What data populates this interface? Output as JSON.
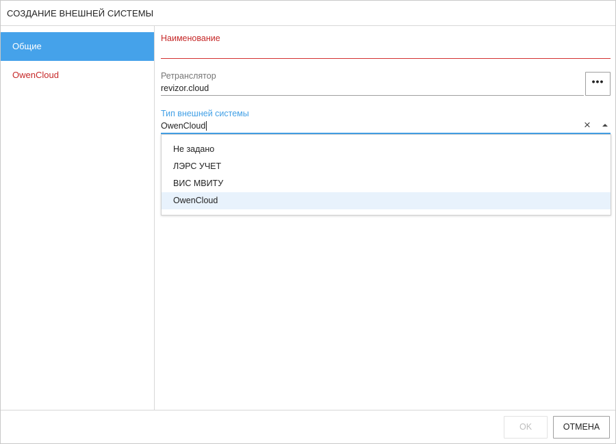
{
  "dialog": {
    "title": "СОЗДАНИЕ ВНЕШНЕЙ СИСТЕМЫ"
  },
  "sidebar": {
    "items": [
      {
        "label": "Общие",
        "state": "active"
      },
      {
        "label": "OwenCloud",
        "state": "error"
      }
    ]
  },
  "form": {
    "name": {
      "label": "Наименование",
      "value": "",
      "state": "error"
    },
    "relay": {
      "label": "Ретранслятор",
      "value": "revizor.cloud",
      "button_label": "•••"
    },
    "system_type": {
      "label": "Тип внешней системы",
      "value": "OwenCloud",
      "clear_icon": "close-icon",
      "toggle_icon": "arrow-up-icon",
      "options": [
        "Не задано",
        "ЛЭРС УЧЕТ",
        "ВИС МВИТУ",
        "OwenCloud"
      ],
      "selected_index": 3
    }
  },
  "footer": {
    "ok_label": "OK",
    "cancel_label": "ОТМЕНА"
  },
  "colors": {
    "accent": "#45a2ea",
    "error": "#c62828",
    "focus": "#42a0e6"
  }
}
